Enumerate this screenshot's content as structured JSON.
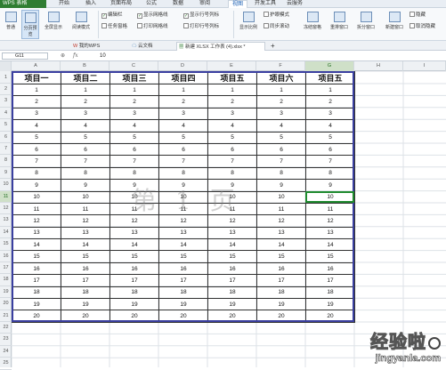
{
  "app": {
    "title": "WPS 表格"
  },
  "menu": [
    "开始",
    "插入",
    "页面布局",
    "公式",
    "数据",
    "审阅",
    "视图",
    "开发工具",
    "云服务"
  ],
  "active_menu": "视图",
  "ribbon": {
    "buttons": [
      "普通",
      "分页预览",
      "全屏显示",
      "阅读模式"
    ],
    "checks_col1": [
      "编辑栏",
      "任务窗格"
    ],
    "checks_col2": [
      "显示网格线",
      "打印网格线"
    ],
    "checks_col3": [
      "显示行号列标",
      "打印行号列标"
    ],
    "buttons2": [
      "显示比例",
      "护眼模式",
      "冻结窗格",
      "重排窗口",
      "拆分窗口",
      "新建窗口",
      "隐藏",
      "取消隐藏"
    ],
    "ribbon_extra": "同步滚动"
  },
  "doc_tabs": [
    "我的WPS",
    "云文档",
    "新建 XLSX 工作表 (4).xlsx *"
  ],
  "formula_bar": {
    "cell": "G11",
    "fx": "fx",
    "value": "10"
  },
  "columns": [
    "A",
    "B",
    "C",
    "D",
    "E",
    "F",
    "G",
    "H",
    "I"
  ],
  "selected_column": "G",
  "selected_row": 11,
  "rows": [
    "1",
    "2",
    "3",
    "4",
    "5",
    "6",
    "7",
    "8",
    "9",
    "10",
    "11",
    "12",
    "13",
    "14",
    "15",
    "16",
    "17",
    "18",
    "19",
    "20",
    "21",
    "22",
    "23",
    "24",
    "25"
  ],
  "table": {
    "headers": [
      "项目一",
      "项目二",
      "项目三",
      "项目四",
      "项目五",
      "项目六",
      "项目五"
    ],
    "values": [
      1,
      2,
      3,
      4,
      5,
      6,
      7,
      8,
      9,
      10,
      11,
      12,
      13,
      14,
      15,
      16,
      17,
      18,
      19,
      20
    ]
  },
  "watermark": "第 1 页",
  "brand": {
    "name": "经验啦",
    "url": "jingyanla.com"
  },
  "colors": {
    "selection": "#1e8a2e",
    "table_border": "#3a3fa0",
    "logo_bg": "#2f7d32"
  }
}
